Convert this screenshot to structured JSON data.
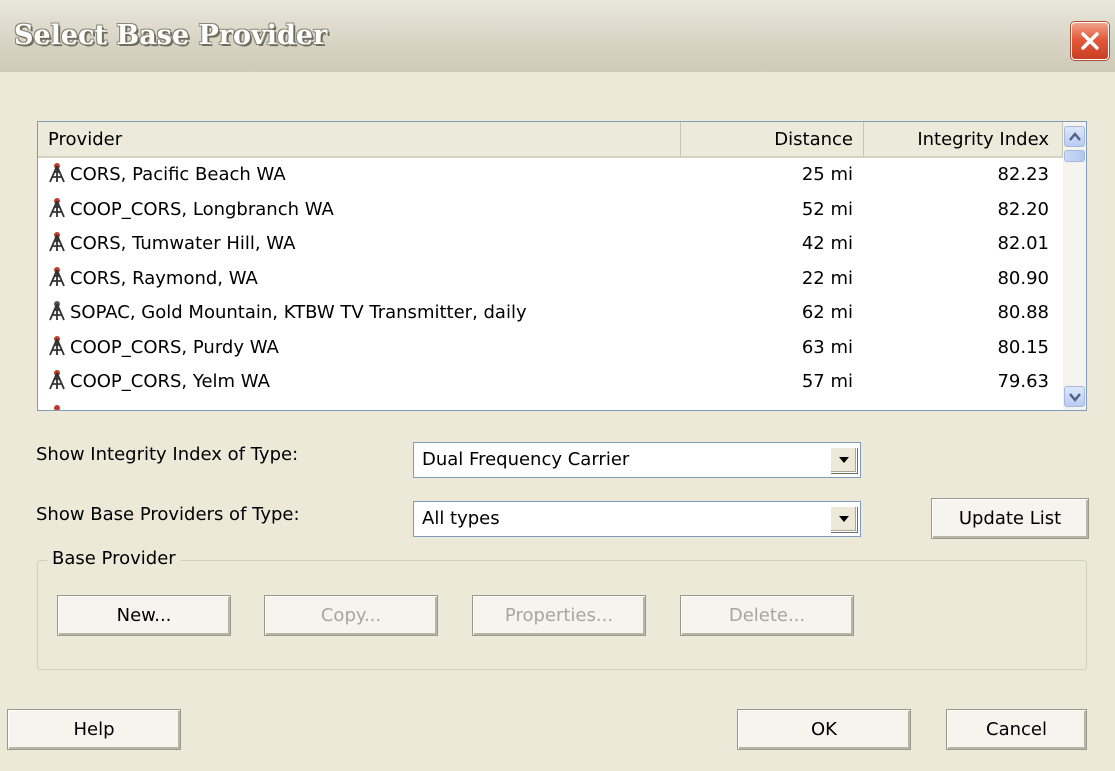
{
  "window": {
    "title": "Select Base Provider",
    "close_icon": "close-icon"
  },
  "list": {
    "columns": {
      "provider": "Provider",
      "distance": "Distance",
      "integrity": "Integrity Index"
    },
    "rows": [
      {
        "provider": "CORS, Pacific Beach WA",
        "distance": "25 mi",
        "integrity": "82.23"
      },
      {
        "provider": "COOP_CORS, Longbranch WA",
        "distance": "52 mi",
        "integrity": "82.20"
      },
      {
        "provider": "CORS, Tumwater Hill, WA",
        "distance": "42 mi",
        "integrity": "82.01"
      },
      {
        "provider": "CORS, Raymond, WA",
        "distance": "22 mi",
        "integrity": "80.90"
      },
      {
        "provider": "SOPAC, Gold Mountain, KTBW TV Transmitter, daily",
        "distance": "62 mi",
        "integrity": "80.88"
      },
      {
        "provider": "COOP_CORS, Purdy WA",
        "distance": "63 mi",
        "integrity": "80.15"
      },
      {
        "provider": "COOP_CORS, Yelm WA",
        "distance": "57 mi",
        "integrity": "79.63"
      }
    ],
    "row_icon": "survey-tower-icon"
  },
  "filters": {
    "integrity_label": "Show Integrity Index of Type:",
    "integrity_value": "Dual Frequency Carrier",
    "providers_label": "Show Base Providers of Type:",
    "providers_value": "All types",
    "update_button": "Update List"
  },
  "base_provider": {
    "legend": "Base Provider",
    "new_button": "New...",
    "copy_button": "Copy...",
    "properties_button": "Properties...",
    "delete_button": "Delete..."
  },
  "footer": {
    "help_button": "Help",
    "ok_button": "OK",
    "cancel_button": "Cancel"
  },
  "colors": {
    "dialog_bg": "#ece9d8",
    "close_red": "#e3593a",
    "scroll_blue": "#b7cbf3"
  }
}
